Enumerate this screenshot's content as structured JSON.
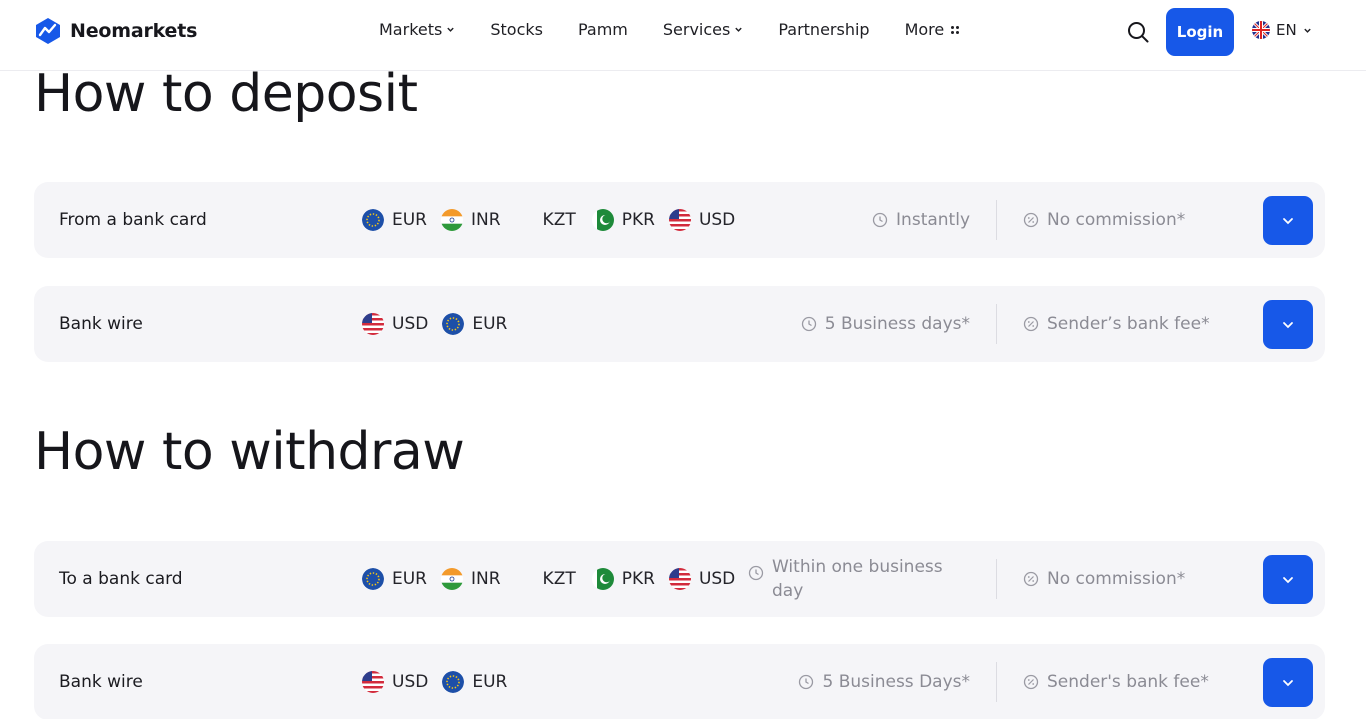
{
  "brand": {
    "name": "Neomarkets",
    "accent": "#1758e8"
  },
  "nav": {
    "items": [
      {
        "label": "Markets",
        "dropdown": true
      },
      {
        "label": "Stocks",
        "dropdown": false
      },
      {
        "label": "Pamm",
        "dropdown": false
      },
      {
        "label": "Services",
        "dropdown": true
      },
      {
        "label": "Partnership",
        "dropdown": false
      },
      {
        "label": "More",
        "dropdown": false
      }
    ],
    "login_label": "Login",
    "language": "EN"
  },
  "deposit": {
    "title": "How to deposit",
    "methods": [
      {
        "name": "From a bank card",
        "currencies": [
          "EUR",
          "INR",
          "KZT",
          "PKR",
          "USD"
        ],
        "time": "Instantly",
        "fee": "No commission*"
      },
      {
        "name": "Bank wire",
        "currencies": [
          "USD",
          "EUR"
        ],
        "time": "5 Business days*",
        "fee": "Sender’s bank fee*"
      }
    ]
  },
  "withdraw": {
    "title": "How to withdraw",
    "methods": [
      {
        "name": "To a bank card",
        "currencies": [
          "EUR",
          "INR",
          "KZT",
          "PKR",
          "USD"
        ],
        "time": "Within one business day",
        "fee": "No commission*"
      },
      {
        "name": "Bank wire",
        "currencies": [
          "USD",
          "EUR"
        ],
        "time": "5 Business Days*",
        "fee": "Sender's bank fee*"
      }
    ]
  }
}
